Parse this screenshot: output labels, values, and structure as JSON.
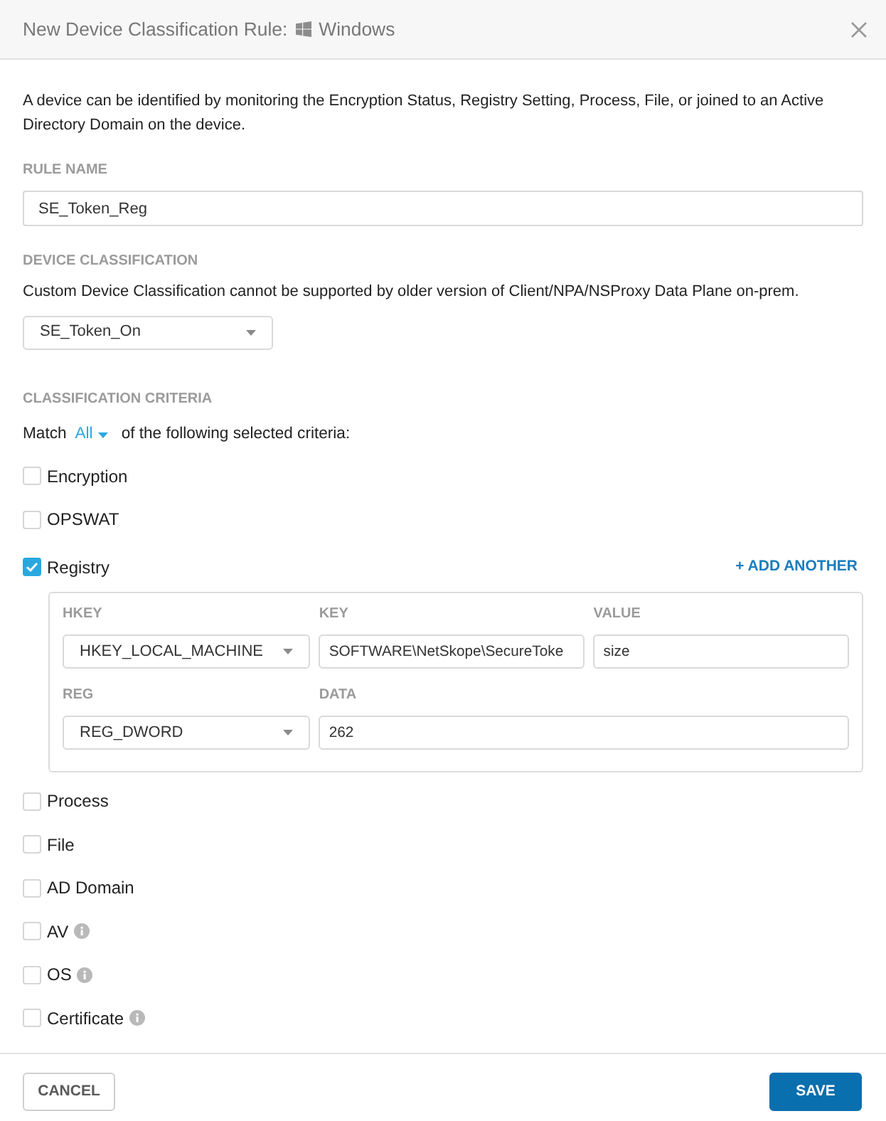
{
  "dialog": {
    "title": "New Device Classification Rule:",
    "platform": "Windows"
  },
  "description": "A device can be identified by monitoring the Encryption Status, Registry Setting, Process, File, or joined to an Active Directory Domain on the device.",
  "rule_name": {
    "label": "RULE NAME",
    "value": "SE_Token_Reg"
  },
  "device_classification": {
    "label": "DEVICE CLASSIFICATION",
    "note": "Custom Device Classification cannot be supported by older version of Client/NPA/NSProxy Data Plane on-prem.",
    "value": "SE_Token_On"
  },
  "criteria": {
    "label": "CLASSIFICATION CRITERIA",
    "match": {
      "prefix": "Match",
      "value": "All",
      "suffix": "of the following selected criteria:"
    },
    "items": [
      {
        "label": "Encryption",
        "checked": false,
        "info": false
      },
      {
        "label": "OPSWAT",
        "checked": false,
        "info": false
      },
      {
        "label": "Registry",
        "checked": true,
        "info": false,
        "action": "+ ADD ANOTHER",
        "rows": [
          [
            {
              "kind": "select",
              "label": "HKEY",
              "value": "HKEY_LOCAL_MACHINE"
            },
            {
              "kind": "input",
              "label": "KEY",
              "value": "SOFTWARE\\NetSkope\\SecureToke"
            },
            {
              "kind": "input",
              "label": "VALUE",
              "value": "size"
            }
          ],
          [
            {
              "kind": "select",
              "label": "REG",
              "value": "REG_DWORD"
            },
            {
              "kind": "input",
              "label": "DATA",
              "value": "262"
            }
          ]
        ]
      },
      {
        "label": "Process",
        "checked": false,
        "info": false
      },
      {
        "label": "File",
        "checked": false,
        "info": false
      },
      {
        "label": "AD Domain",
        "checked": false,
        "info": false
      },
      {
        "label": "AV",
        "checked": false,
        "info": true
      },
      {
        "label": "OS",
        "checked": false,
        "info": true
      },
      {
        "label": "Certificate",
        "checked": false,
        "info": true
      }
    ]
  },
  "footer": {
    "buttons": [
      {
        "label": "CANCEL",
        "kind": "cancel"
      },
      {
        "label": "SAVE",
        "kind": "save"
      }
    ]
  }
}
